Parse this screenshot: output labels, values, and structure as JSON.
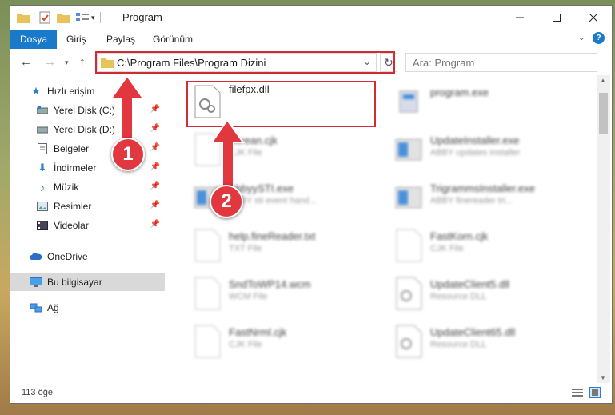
{
  "titlebar": {
    "title": "Program"
  },
  "ribbon": {
    "file_tab": "Dosya",
    "tabs": [
      "Giriş",
      "Paylaş",
      "Görünüm"
    ]
  },
  "address": {
    "path": "C:\\Program Files\\Program Dizini"
  },
  "search": {
    "placeholder": "Ara: Program"
  },
  "sidebar": {
    "quick_access": "Hızlı erişim",
    "items": [
      {
        "label": "Yerel Disk (C:)",
        "icon": "drive-icon"
      },
      {
        "label": "Yerel Disk (D:)",
        "icon": "drive-icon"
      },
      {
        "label": "Belgeler",
        "icon": "documents-icon"
      },
      {
        "label": "İndirmeler",
        "icon": "download-icon"
      },
      {
        "label": "Müzik",
        "icon": "music-icon"
      },
      {
        "label": "Resimler",
        "icon": "pictures-icon"
      },
      {
        "label": "Videolar",
        "icon": "videos-icon"
      }
    ],
    "onedrive": "OneDrive",
    "this_pc": "Bu bilgisayar",
    "network": "Ağ"
  },
  "files": {
    "left": [
      {
        "name": "filefpx.dll",
        "type": ""
      },
      {
        "name": "Screan.cjk",
        "type": "CJK File"
      },
      {
        "name": "AbbyySTI.exe",
        "type": "ABBY sti event hand..."
      },
      {
        "name": "help.fineReader.txt",
        "type": "TXT File"
      },
      {
        "name": "SndToWP14.wcm",
        "type": "WCM File"
      },
      {
        "name": "FastNrml.cjk",
        "type": "CJK File"
      }
    ],
    "right": [
      {
        "name": "program.exe",
        "type": ""
      },
      {
        "name": "UpdateInstaller.exe",
        "type": "ABBY updates installer"
      },
      {
        "name": "TrigrammsInstaller.exe",
        "type": "ABBY finereader tri..."
      },
      {
        "name": "FastKorn.cjk",
        "type": "CJK File"
      },
      {
        "name": "UpdateClient5.dll",
        "type": "Resource DLL"
      },
      {
        "name": "UpdateClient65.dll",
        "type": "Resource DLL"
      }
    ]
  },
  "status": {
    "count": "113 öğe"
  },
  "annotations": {
    "badge1": "1",
    "badge2": "2"
  },
  "colors": {
    "accent": "#1979ca",
    "highlight": "#d12b34",
    "badge": "#e0383e"
  }
}
